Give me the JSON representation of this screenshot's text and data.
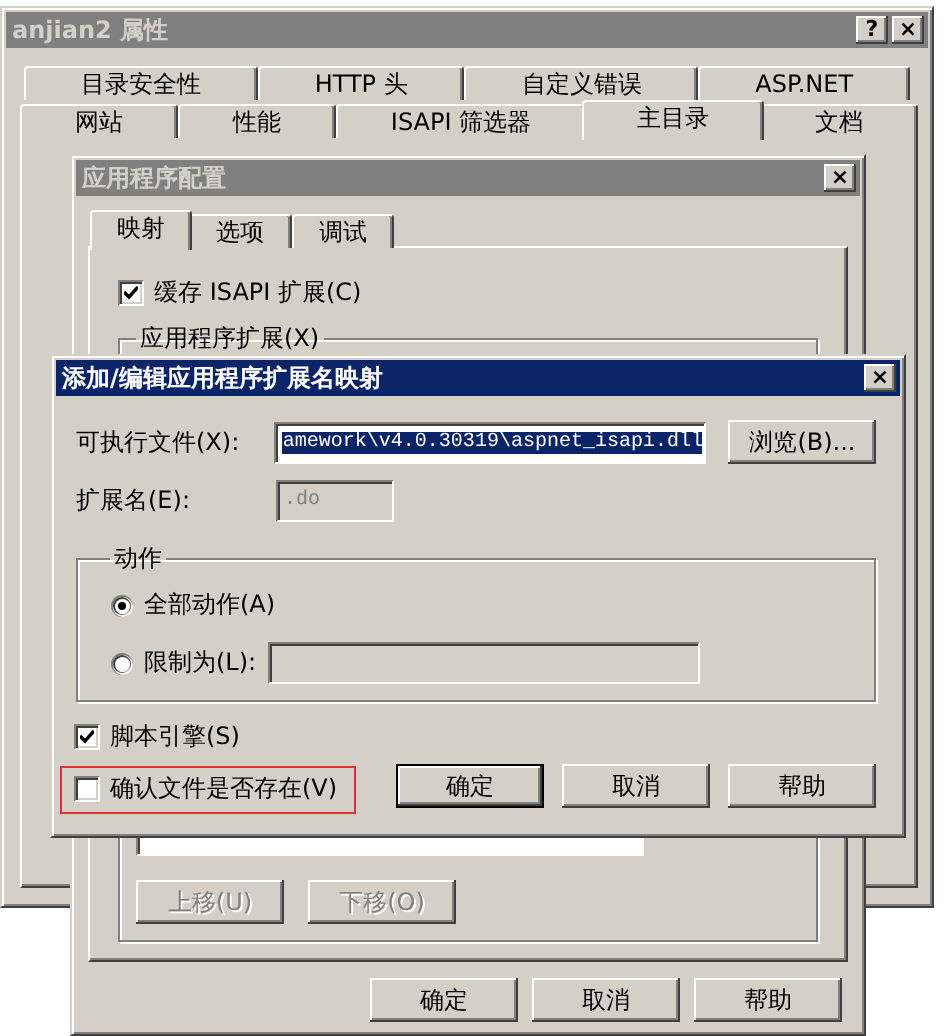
{
  "properties_window": {
    "title": "anjian2 属性",
    "active": false,
    "title_buttons": [
      "?",
      "×"
    ],
    "tab_rows": [
      [
        {
          "label": "目录安全性",
          "selected": false
        },
        {
          "label": "HTTP 头",
          "selected": false
        },
        {
          "label": "自定义错误",
          "selected": false
        },
        {
          "label": "ASP.NET",
          "selected": false
        }
      ],
      [
        {
          "label": "网站",
          "selected": false
        },
        {
          "label": "性能",
          "selected": false
        },
        {
          "label": "ISAPI 筛选器",
          "selected": false
        },
        {
          "label": "主目录",
          "selected": true
        },
        {
          "label": "文档",
          "selected": false
        }
      ]
    ]
  },
  "app_config_window": {
    "title": "应用程序配置",
    "active": false,
    "title_buttons": [
      "×"
    ],
    "tabs": [
      {
        "label": "映射",
        "selected": true
      },
      {
        "label": "选项",
        "selected": false
      },
      {
        "label": "调试",
        "selected": false
      }
    ],
    "cache_checkbox": {
      "label": "缓存 ISAPI 扩展(C)",
      "checked": true
    },
    "extensions_group": {
      "title": "应用程序扩展(X)",
      "buttons": [
        {
          "label": "上移(U)",
          "disabled": true
        },
        {
          "label": "下移(O)",
          "disabled": true
        }
      ]
    },
    "buttons": [
      {
        "label": "确定",
        "default": false
      },
      {
        "label": "取消",
        "default": false
      },
      {
        "label": "帮助",
        "default": false
      }
    ]
  },
  "mapping_dialog": {
    "title": "添加/编辑应用程序扩展名映射",
    "active": true,
    "title_buttons": [
      "×"
    ],
    "executable": {
      "label": "可执行文件(X):",
      "value": "amework\\v4.0.30319\\aspnet_isapi.dll",
      "text_selected": true,
      "disabled": false
    },
    "browse_button": "浏览(B)...",
    "extension": {
      "label": "扩展名(E):",
      "value": ".do",
      "text_selected": false,
      "disabled": true
    },
    "verbs_group": {
      "title": "动作",
      "options": [
        {
          "kind": "plain",
          "label": "全部动作(A)",
          "selected": true
        },
        {
          "kind": "with_field",
          "label": "限制为(L):",
          "selected": false,
          "field_disabled": true
        }
      ]
    },
    "checkboxes": [
      {
        "label": "脚本引擎(S)",
        "checked": true,
        "highlighted": false
      },
      {
        "label": "确认文件是否存在(V)",
        "checked": false,
        "highlighted": true
      }
    ],
    "buttons": [
      {
        "label": "确定",
        "default": true
      },
      {
        "label": "取消",
        "default": false
      },
      {
        "label": "帮助",
        "default": false
      }
    ]
  }
}
